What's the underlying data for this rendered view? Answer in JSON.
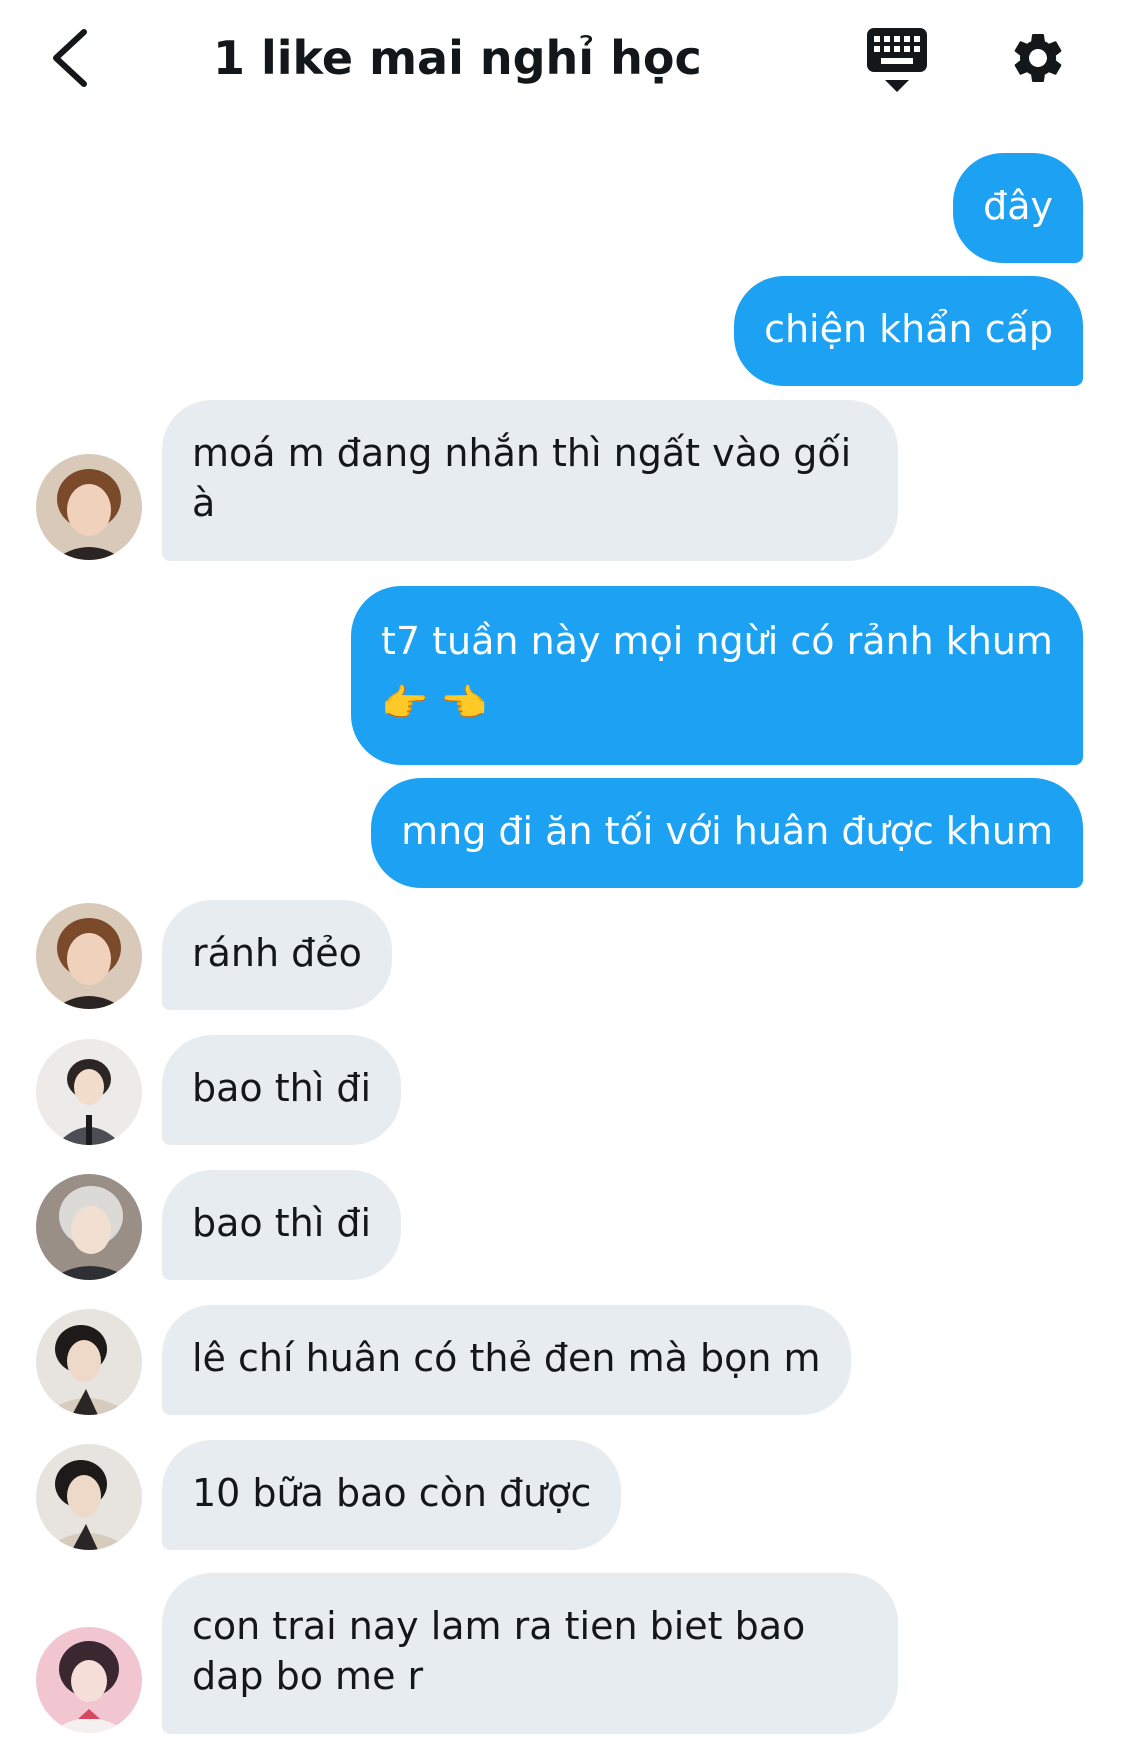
{
  "header": {
    "title": "1 like mai nghỉ học",
    "back_icon": "chevron-left-icon",
    "keyboard_icon": "keyboard-icon",
    "settings_icon": "gear-icon"
  },
  "colors": {
    "outgoing_bubble": "#1da1f2",
    "incoming_bubble": "#e6ecf0",
    "text": "#14171a"
  },
  "messages": [
    {
      "direction": "out",
      "text": "đây"
    },
    {
      "direction": "out",
      "text": "chiện khẩn cấp"
    },
    {
      "direction": "in",
      "text": "moá m đang nhắn thì ngất vào gối à"
    },
    {
      "direction": "out",
      "text": "t7 tuần này mọi ngừi có rảnh khum 👉 👈"
    },
    {
      "direction": "out",
      "text": "mng đi ăn tối với huân được khum"
    },
    {
      "direction": "in",
      "text": "ránh đẻo"
    },
    {
      "direction": "in",
      "text": "bao thì đi"
    },
    {
      "direction": "in",
      "text": "bao thì đi"
    },
    {
      "direction": "in",
      "text": "lê chí huân có thẻ đen mà bọn m"
    },
    {
      "direction": "in",
      "text": "10 bữa bao còn được"
    },
    {
      "direction": "in",
      "text": "con trai nay lam ra tien biet bao dap bo me r"
    }
  ]
}
